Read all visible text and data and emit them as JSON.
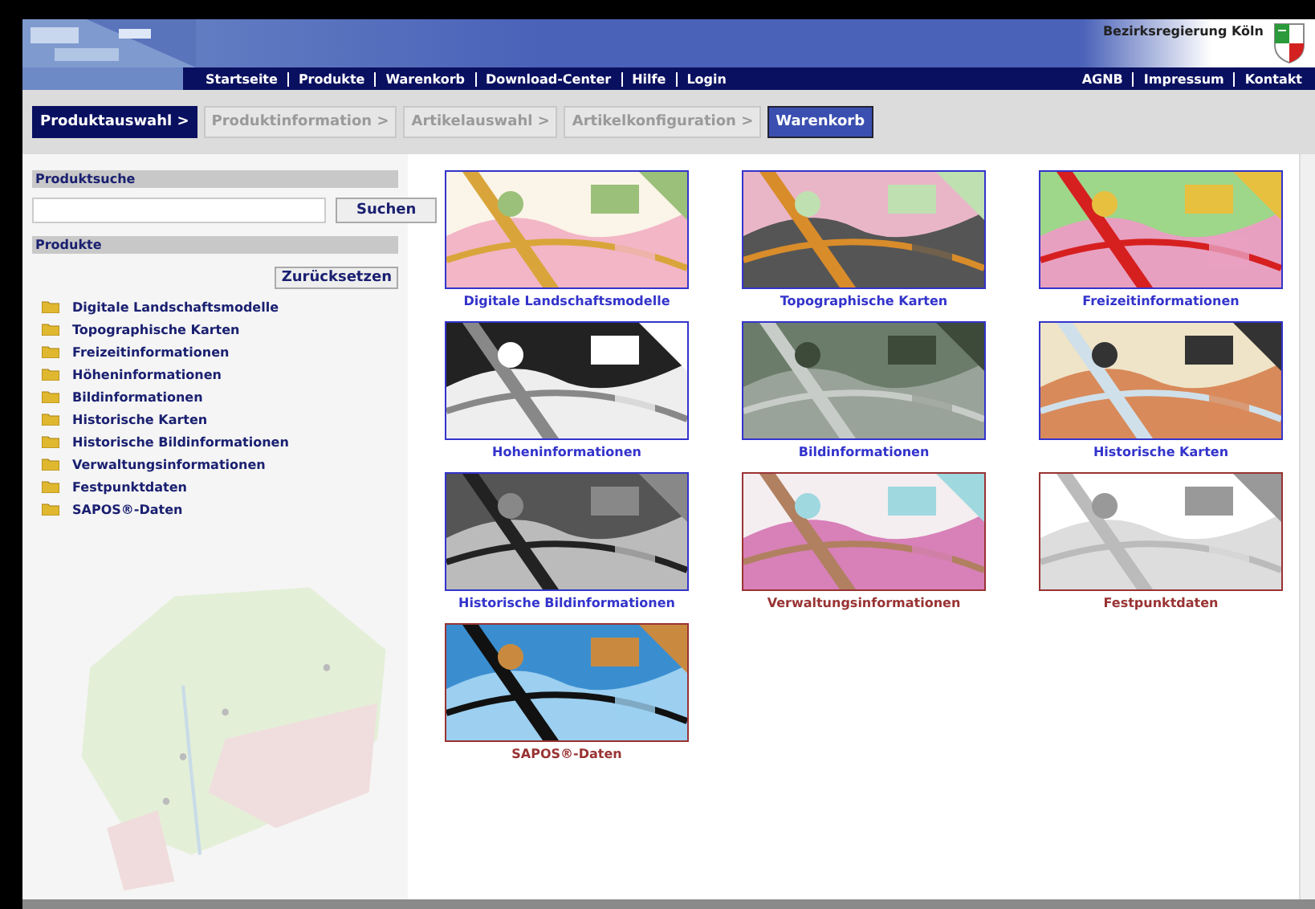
{
  "header": {
    "organization": "Bezirksregierung Köln",
    "nav_left": [
      "Startseite",
      "Produkte",
      "Warenkorb",
      "Download-Center",
      "Hilfe",
      "Login"
    ],
    "nav_right": [
      "AGNB",
      "Impressum",
      "Kontakt"
    ]
  },
  "steps": [
    {
      "label": "Produktauswahl >",
      "selected": true,
      "disabled": false
    },
    {
      "label": "Produktinformation >",
      "selected": false,
      "disabled": true
    },
    {
      "label": "Artikelauswahl >",
      "selected": false,
      "disabled": true
    },
    {
      "label": "Artikelkonfiguration >",
      "selected": false,
      "disabled": true
    },
    {
      "label": "Warenkorb",
      "selected": false,
      "disabled": false
    }
  ],
  "sidebar": {
    "search_title": "Produktsuche",
    "search_button": "Suchen",
    "products_title": "Produkte",
    "reset_button": "Zurücksetzen",
    "items": [
      "Digitale Landschaftsmodelle",
      "Topographische Karten",
      "Freizeitinformationen",
      "Höheninformationen",
      "Bildinformationen",
      "Historische Karten",
      "Historische Bildinformationen",
      "Verwaltungsinformationen",
      "Festpunktdaten",
      "SAPOS®-Daten"
    ]
  },
  "tiles": [
    {
      "label": "Digitale Landschaftsmodelle",
      "color": "#3333cc"
    },
    {
      "label": "Topographische Karten",
      "color": "#3333cc"
    },
    {
      "label": "Freizeitinformationen",
      "color": "#3333cc"
    },
    {
      "label": "Hoheninformationen",
      "color": "#3333cc"
    },
    {
      "label": "Bildinformationen",
      "color": "#3333cc"
    },
    {
      "label": "Historische Karten",
      "color": "#3333cc"
    },
    {
      "label": "Historische Bildinformationen",
      "color": "#3333cc"
    },
    {
      "label": "Verwaltungsinformationen",
      "color": "#993333"
    },
    {
      "label": "Festpunktdaten",
      "color": "#993333"
    },
    {
      "label": "SAPOS®-Daten",
      "color": "#993333"
    }
  ]
}
